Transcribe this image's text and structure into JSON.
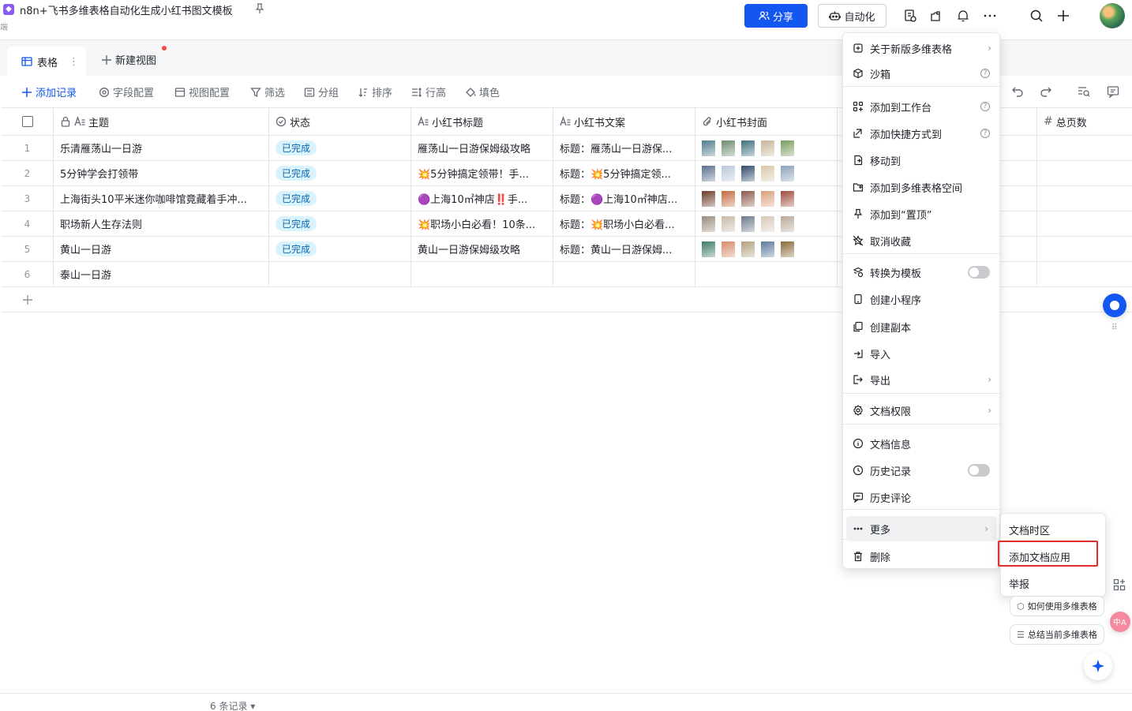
{
  "header": {
    "title": "n8n+飞书多维表格自动化生成小红书图文模板",
    "subtitle": "端",
    "share_label": "分享",
    "automation_label": "自动化"
  },
  "tabs": {
    "active_label": "表格",
    "new_view_label": "新建视图"
  },
  "toolbar": {
    "add_record": "添加记录",
    "field_config": "字段配置",
    "view_config": "视图配置",
    "filter": "筛选",
    "group": "分组",
    "sort": "排序",
    "row_height": "行高",
    "fill_color": "填色"
  },
  "table": {
    "columns": [
      "主题",
      "状态",
      "小红书标题",
      "小红书文案",
      "小红书封面",
      "总页数"
    ],
    "rows": [
      {
        "num": "1",
        "topic": "乐清雁荡山一日游",
        "status": "已完成",
        "title": "雁荡山一日游保姆级攻略",
        "copy": "标题：雁荡山一日游保..."
      },
      {
        "num": "2",
        "topic": "5分钟学会打领带",
        "status": "已完成",
        "title": "💥5分钟搞定领带！手...",
        "copy": "标题：💥5分钟搞定领..."
      },
      {
        "num": "3",
        "topic": "上海街头10平米迷你咖啡馆竟藏着手冲...",
        "status": "已完成",
        "title": "🟣上海10㎡神店‼️手...",
        "copy": "标题：🟣上海10㎡神店..."
      },
      {
        "num": "4",
        "topic": "职场新人生存法则",
        "status": "已完成",
        "title": "💥职场小白必看！10条...",
        "copy": "标题：💥职场小白必看..."
      },
      {
        "num": "5",
        "topic": "黄山一日游",
        "status": "已完成",
        "title": "黄山一日游保姆级攻略",
        "copy": "标题：黄山一日游保姆..."
      },
      {
        "num": "6",
        "topic": "泰山一日游",
        "status": "",
        "title": "",
        "copy": ""
      }
    ],
    "record_count": "6 条记录"
  },
  "menu": {
    "items": [
      "关于新版多维表格",
      "沙箱",
      "添加到工作台",
      "添加快捷方式到",
      "移动到",
      "添加到多维表格空间",
      "添加到“置顶”",
      "取消收藏",
      "转换为模板",
      "创建小程序",
      "创建副本",
      "导入",
      "导出",
      "文档权限",
      "文档信息",
      "历史记录",
      "历史评论",
      "更多",
      "删除"
    ],
    "submenu": [
      "文档时区",
      "添加文档应用",
      "举报"
    ]
  },
  "assistant": {
    "suggest_1": "如何使用多维表格",
    "suggest_2": "总结当前多维表格"
  },
  "colors": {
    "accent": "#1456f0",
    "status_badge_bg": "#d9f3fd",
    "highlight": "#e02d2d"
  }
}
